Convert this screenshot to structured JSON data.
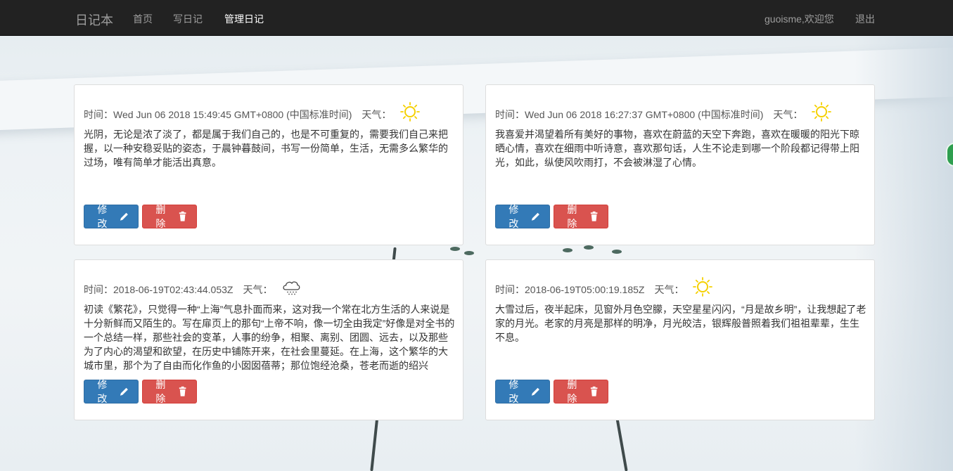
{
  "nav": {
    "brand": "日记本",
    "links": [
      "首页",
      "写日记",
      "管理日记"
    ],
    "user": "guoisme,欢迎您",
    "logout": "退出"
  },
  "cards": [
    {
      "time_label": "时间：",
      "time": "Wed Jun 06 2018 15:49:45 GMT+0800 (中国标准时间)",
      "weather_label": "天气：",
      "weather_icon": "sun-icon",
      "content": "光阴，无论是浓了淡了，都是属于我们自己的，也是不可重复的，需要我们自己来把握，以一种安稳妥贴的姿态，于晨钟暮鼓间，书写一份简单，生活，无需多么繁华的过场，唯有简单才能活出真意。",
      "edit": "修改",
      "delete": "删除"
    },
    {
      "time_label": "时间：",
      "time": "Wed Jun 06 2018 16:27:37 GMT+0800 (中国标准时间)",
      "weather_label": "天气：",
      "weather_icon": "sun-icon",
      "content": "我喜爱并渴望着所有美好的事物，喜欢在蔚蓝的天空下奔跑，喜欢在暖暖的阳光下晾晒心情，喜欢在细雨中听诗意，喜欢那句话，人生不论走到哪一个阶段都记得带上阳光，如此，纵使风吹雨打，不会被淋湿了心情。",
      "edit": "修改",
      "delete": "删除"
    },
    {
      "time_label": "时间：",
      "time": "2018-06-19T02:43:44.053Z",
      "weather_label": "天气：",
      "weather_icon": "snow-cloud-icon",
      "content": "初读《繁花》，只觉得一种“上海”气息扑面而来，这对我一个常在北方生活的人来说是十分新鲜而又陌生的。写在扉页上的那句“上帝不响，像一切全由我定”好像是对全书的一个总结一样，那些社会的变革，人事的纷争，相聚、离别、团圆、远去，以及那些为了内心的渴望和欲望，在历史中铺陈开来，在社会里蔓延。在上海，这个繁华的大城市里，那个为了自由而化作鱼的小囡囡蓓蒂；那位饱经沧桑，苍老而逝的绍兴",
      "edit": "修改",
      "delete": "删除"
    },
    {
      "time_label": "时间：",
      "time": "2018-06-19T05:00:19.185Z",
      "weather_label": "天气：",
      "weather_icon": "sun-icon",
      "content": "大雪过后，夜半起床，见窗外月色空朦，天空星星闪闪，“月是故乡明”，让我想起了老家的月光。老家的月亮是那样的明净，月光皎洁，银辉般普照着我们祖祖辈辈，生生不息。",
      "edit": "修改",
      "delete": "删除"
    }
  ],
  "colors": {
    "navbar_bg": "#222222",
    "primary": "#337ab7",
    "danger": "#d9534f",
    "sun": "#f5d000"
  }
}
